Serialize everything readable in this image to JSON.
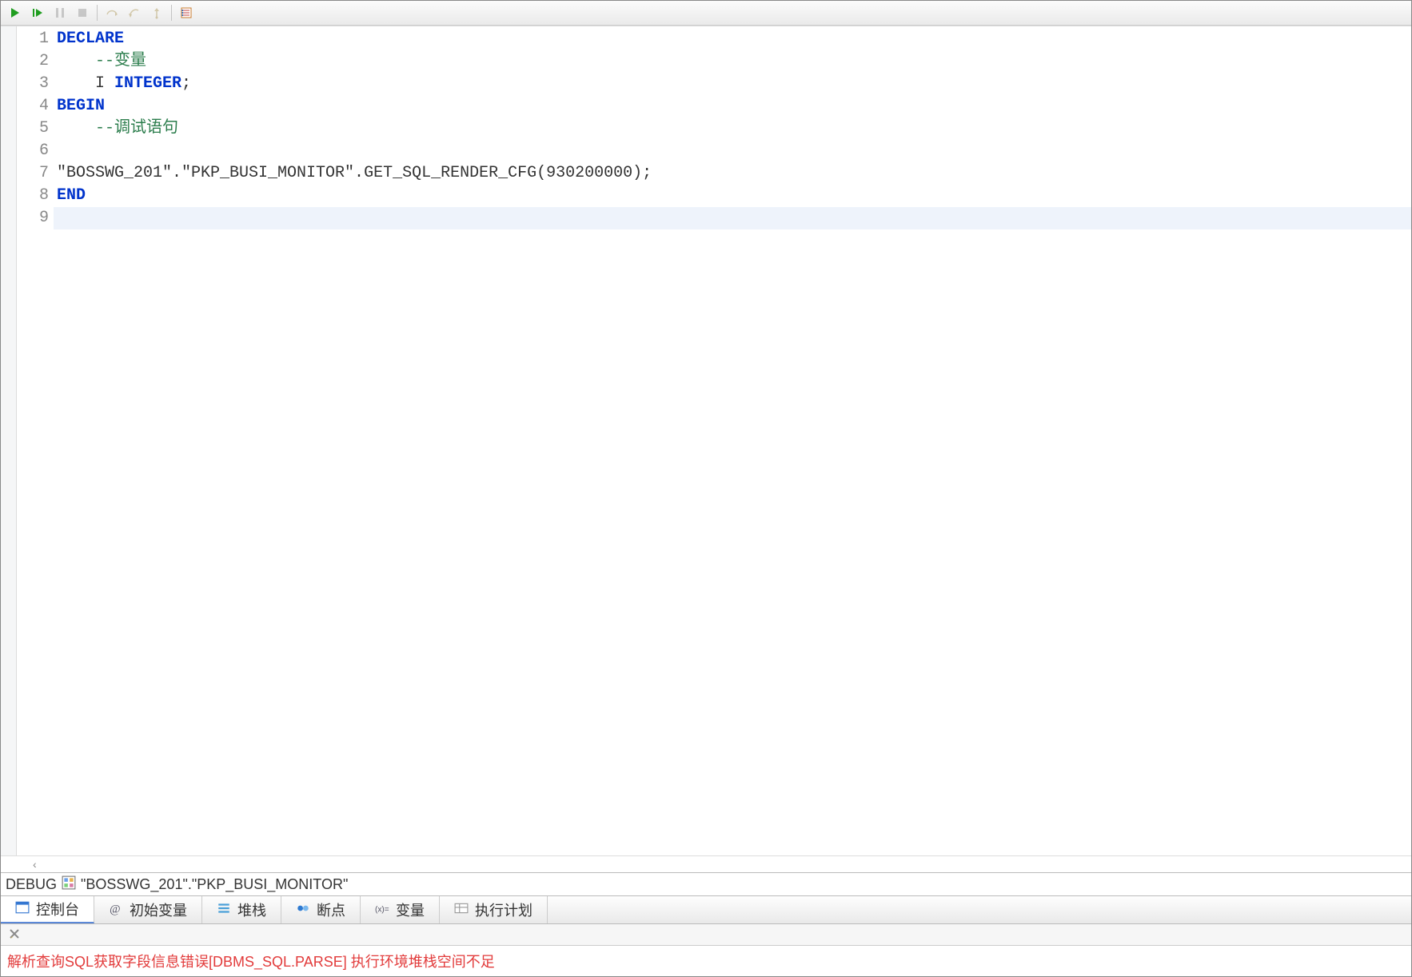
{
  "toolbar": {
    "icons": {
      "play": "play-icon",
      "step": "step-into-icon",
      "pause": "pause-icon",
      "stop": "stop-icon",
      "stepover": "step-over-icon",
      "steprtn": "step-return-icon",
      "stepout": "step-out-icon",
      "options": "debug-options-icon"
    }
  },
  "editor": {
    "breakpoint_line": 7,
    "active_line": 9,
    "lines": [
      {
        "n": 1,
        "tokens": [
          {
            "t": "DECLARE",
            "c": "kw"
          }
        ]
      },
      {
        "n": 2,
        "tokens": [
          {
            "t": "    ",
            "c": ""
          },
          {
            "t": "--变量",
            "c": "cm"
          }
        ]
      },
      {
        "n": 3,
        "tokens": [
          {
            "t": "    I ",
            "c": ""
          },
          {
            "t": "INTEGER",
            "c": "kw"
          },
          {
            "t": ";",
            "c": ""
          }
        ]
      },
      {
        "n": 4,
        "tokens": [
          {
            "t": "BEGIN",
            "c": "kw"
          }
        ]
      },
      {
        "n": 5,
        "tokens": [
          {
            "t": "    ",
            "c": ""
          },
          {
            "t": "--调试语句",
            "c": "cm"
          }
        ]
      },
      {
        "n": 6,
        "tokens": []
      },
      {
        "n": 7,
        "tokens": [
          {
            "t": "\"BOSSWG_201\".\"PKP_BUSI_MONITOR\".GET_SQL_RENDER_CFG(930200000);",
            "c": "str"
          }
        ]
      },
      {
        "n": 8,
        "tokens": [
          {
            "t": "END",
            "c": "kw"
          }
        ]
      },
      {
        "n": 9,
        "tokens": []
      }
    ]
  },
  "debug_bar": {
    "label": "DEBUG",
    "target": "\"BOSSWG_201\".\"PKP_BUSI_MONITOR\""
  },
  "bottom_tabs": [
    {
      "id": "console",
      "label": "控制台",
      "icon": "console-icon",
      "active": true
    },
    {
      "id": "initvars",
      "label": "初始变量",
      "icon": "initvars-icon",
      "active": false
    },
    {
      "id": "stack",
      "label": "堆栈",
      "icon": "stack-icon",
      "active": false
    },
    {
      "id": "breakpts",
      "label": "断点",
      "icon": "breakpoint-icon",
      "active": false
    },
    {
      "id": "vars",
      "label": "变量",
      "icon": "vars-icon",
      "active": false
    },
    {
      "id": "explain",
      "label": "执行计划",
      "icon": "plan-icon",
      "active": false
    }
  ],
  "console": {
    "clear_tool": "clear-console-icon",
    "error_line": "解析查询SQL获取字段信息错误[DBMS_SQL.PARSE] 执行环境堆栈空间不足"
  }
}
